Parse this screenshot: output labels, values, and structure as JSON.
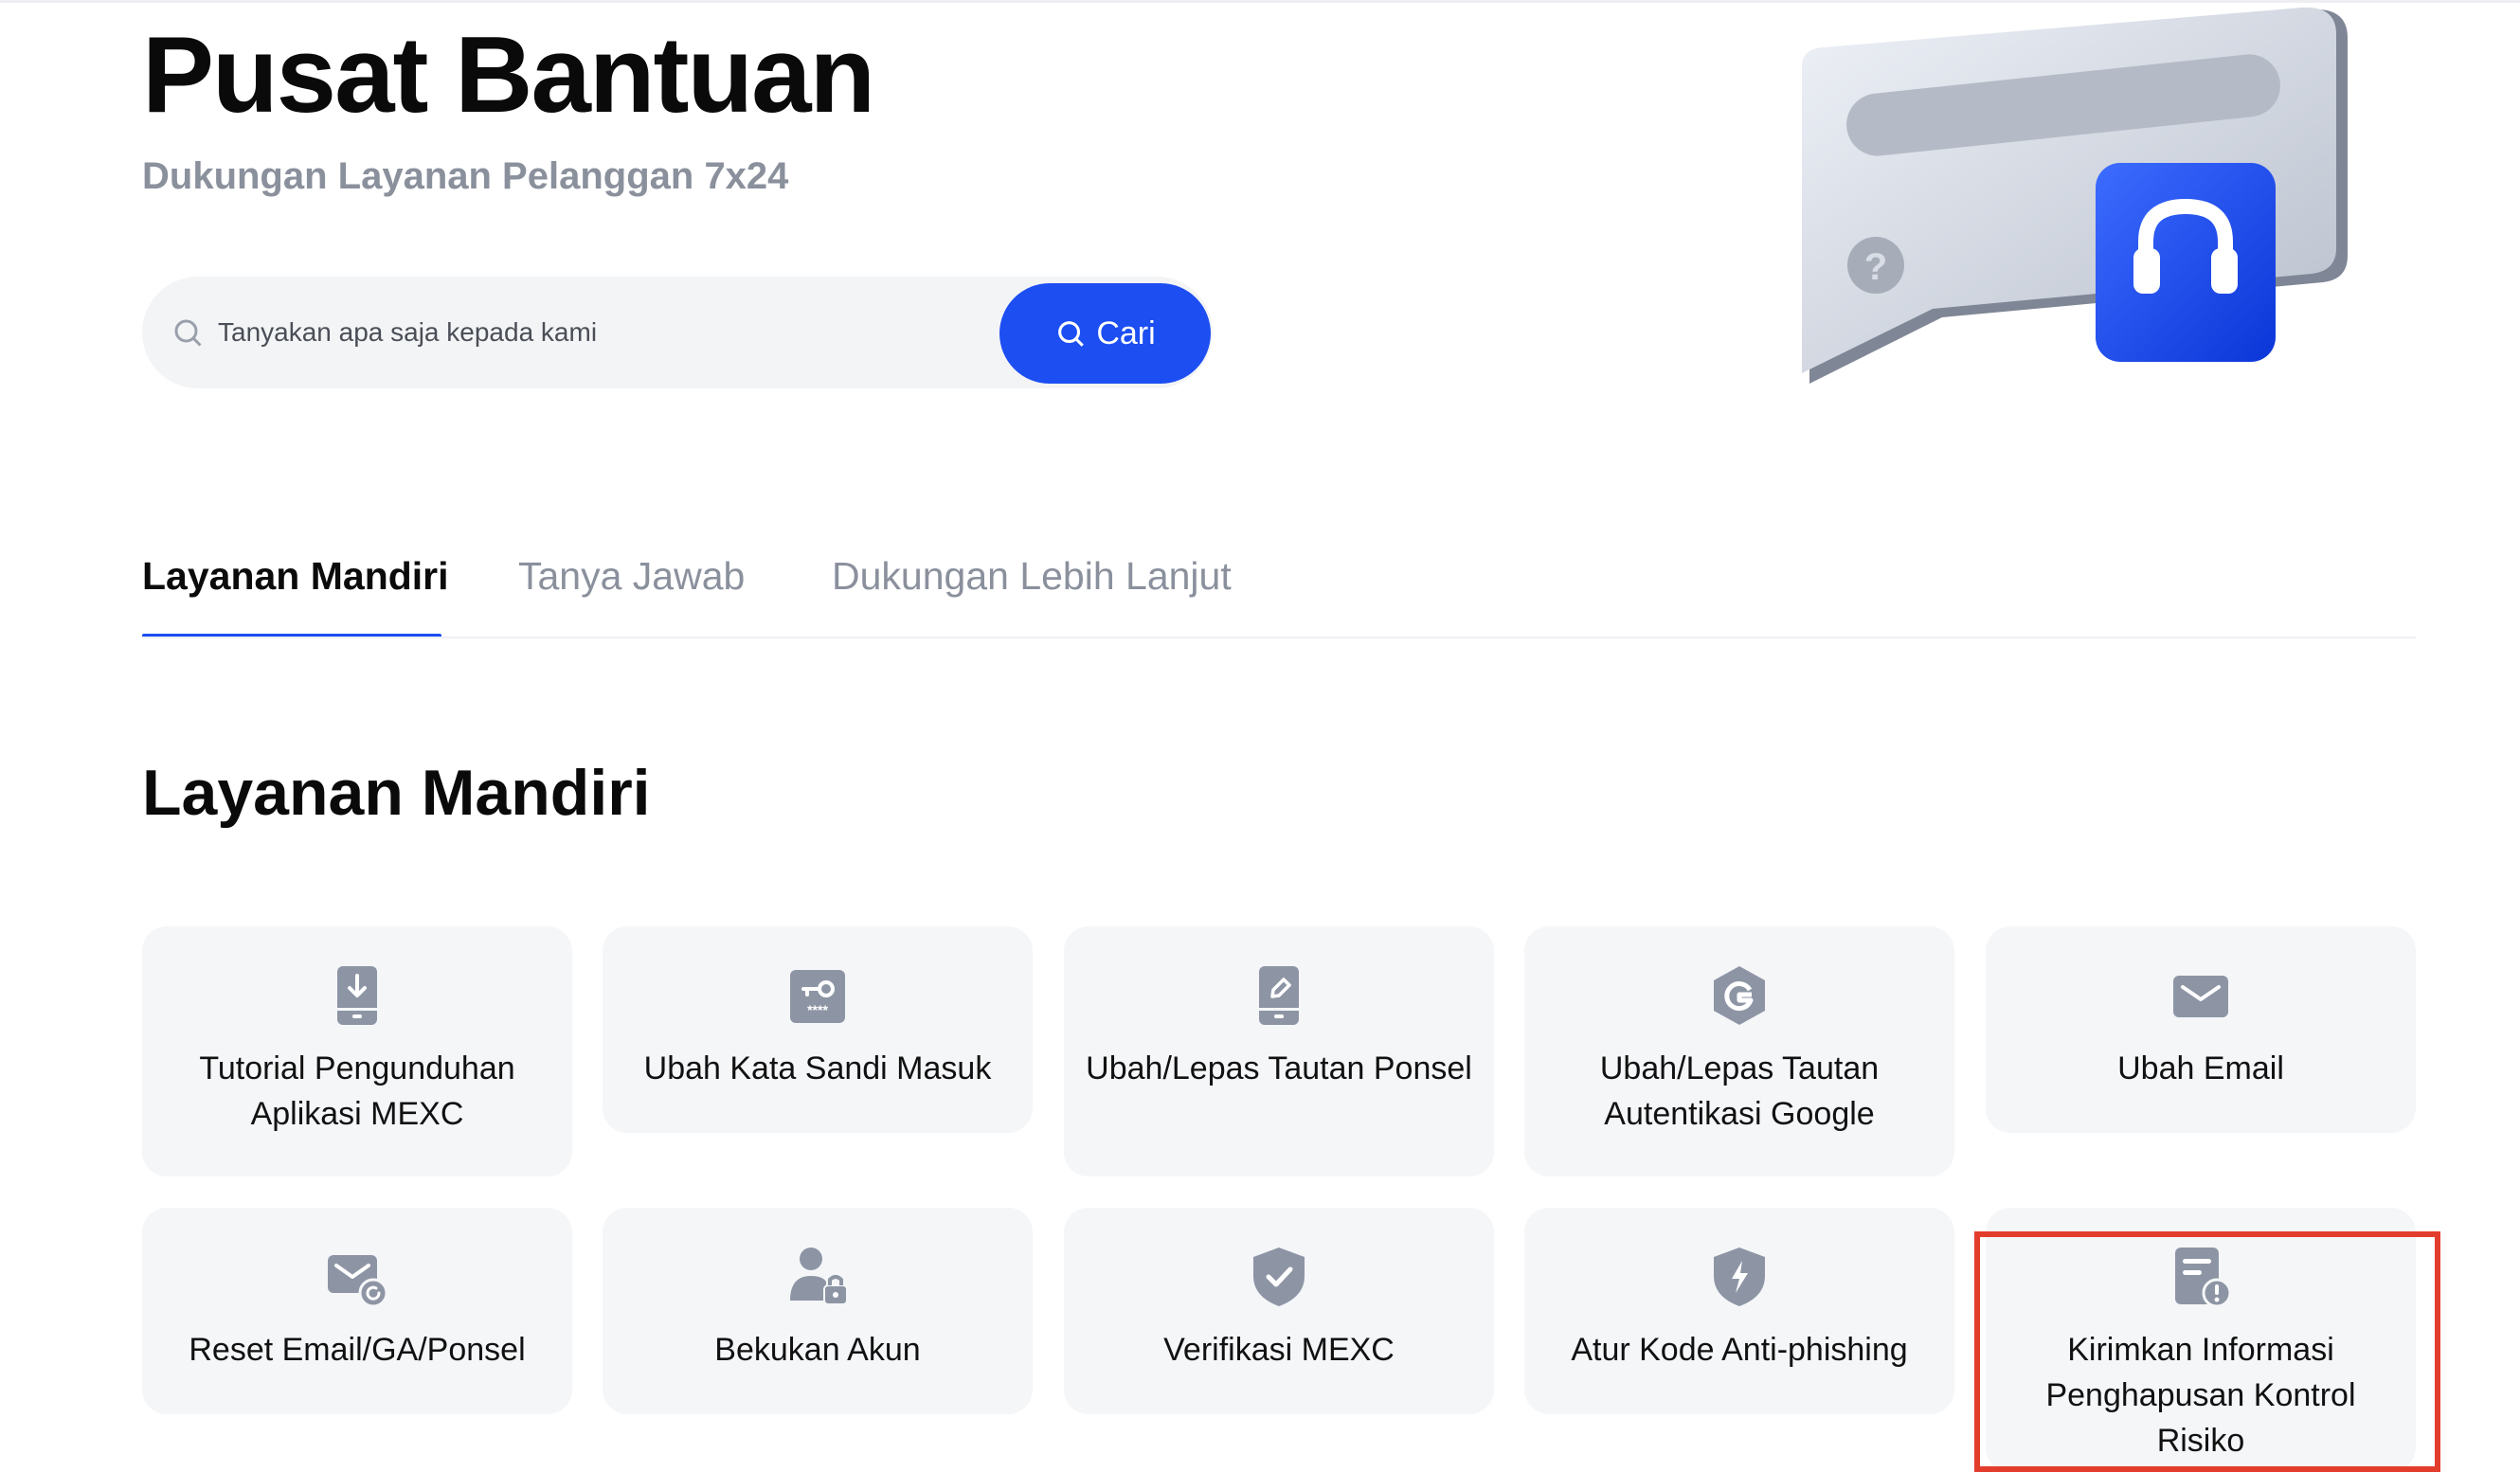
{
  "hero": {
    "title": "Pusat Bantuan",
    "subtitle": "Dukungan Layanan Pelanggan 7x24"
  },
  "search": {
    "placeholder": "Tanyakan apa saja kepada kami",
    "button_label": "Cari"
  },
  "tabs": [
    {
      "label": "Layanan Mandiri",
      "active": true
    },
    {
      "label": "Tanya Jawab",
      "active": false
    },
    {
      "label": "Dukungan Lebih Lanjut",
      "active": false
    }
  ],
  "section": {
    "title": "Layanan Mandiri"
  },
  "services": [
    {
      "label": "Tutorial Pengunduhan Aplikasi MEXC",
      "icon": "download-app-icon"
    },
    {
      "label": "Ubah Kata Sandi Masuk",
      "icon": "password-key-icon"
    },
    {
      "label": "Ubah/Lepas Tautan Ponsel",
      "icon": "phone-edit-icon"
    },
    {
      "label": "Ubah/Lepas Tautan Autentikasi Google",
      "icon": "google-auth-icon"
    },
    {
      "label": "Ubah Email",
      "icon": "email-icon"
    },
    {
      "label": "Reset Email/GA/Ponsel",
      "icon": "email-reset-icon"
    },
    {
      "label": "Bekukan Akun",
      "icon": "user-lock-icon"
    },
    {
      "label": "Verifikasi MEXC",
      "icon": "shield-check-icon"
    },
    {
      "label": "Atur Kode Anti-phishing",
      "icon": "shield-bolt-icon"
    },
    {
      "label": "Kirimkan Informasi Penghapusan Kontrol Risiko",
      "icon": "document-alert-icon"
    }
  ],
  "colors": {
    "accent": "#1c4ef2",
    "icon": "#8d95a5",
    "card_bg": "#f5f6f8",
    "highlight": "#e23d2c"
  }
}
